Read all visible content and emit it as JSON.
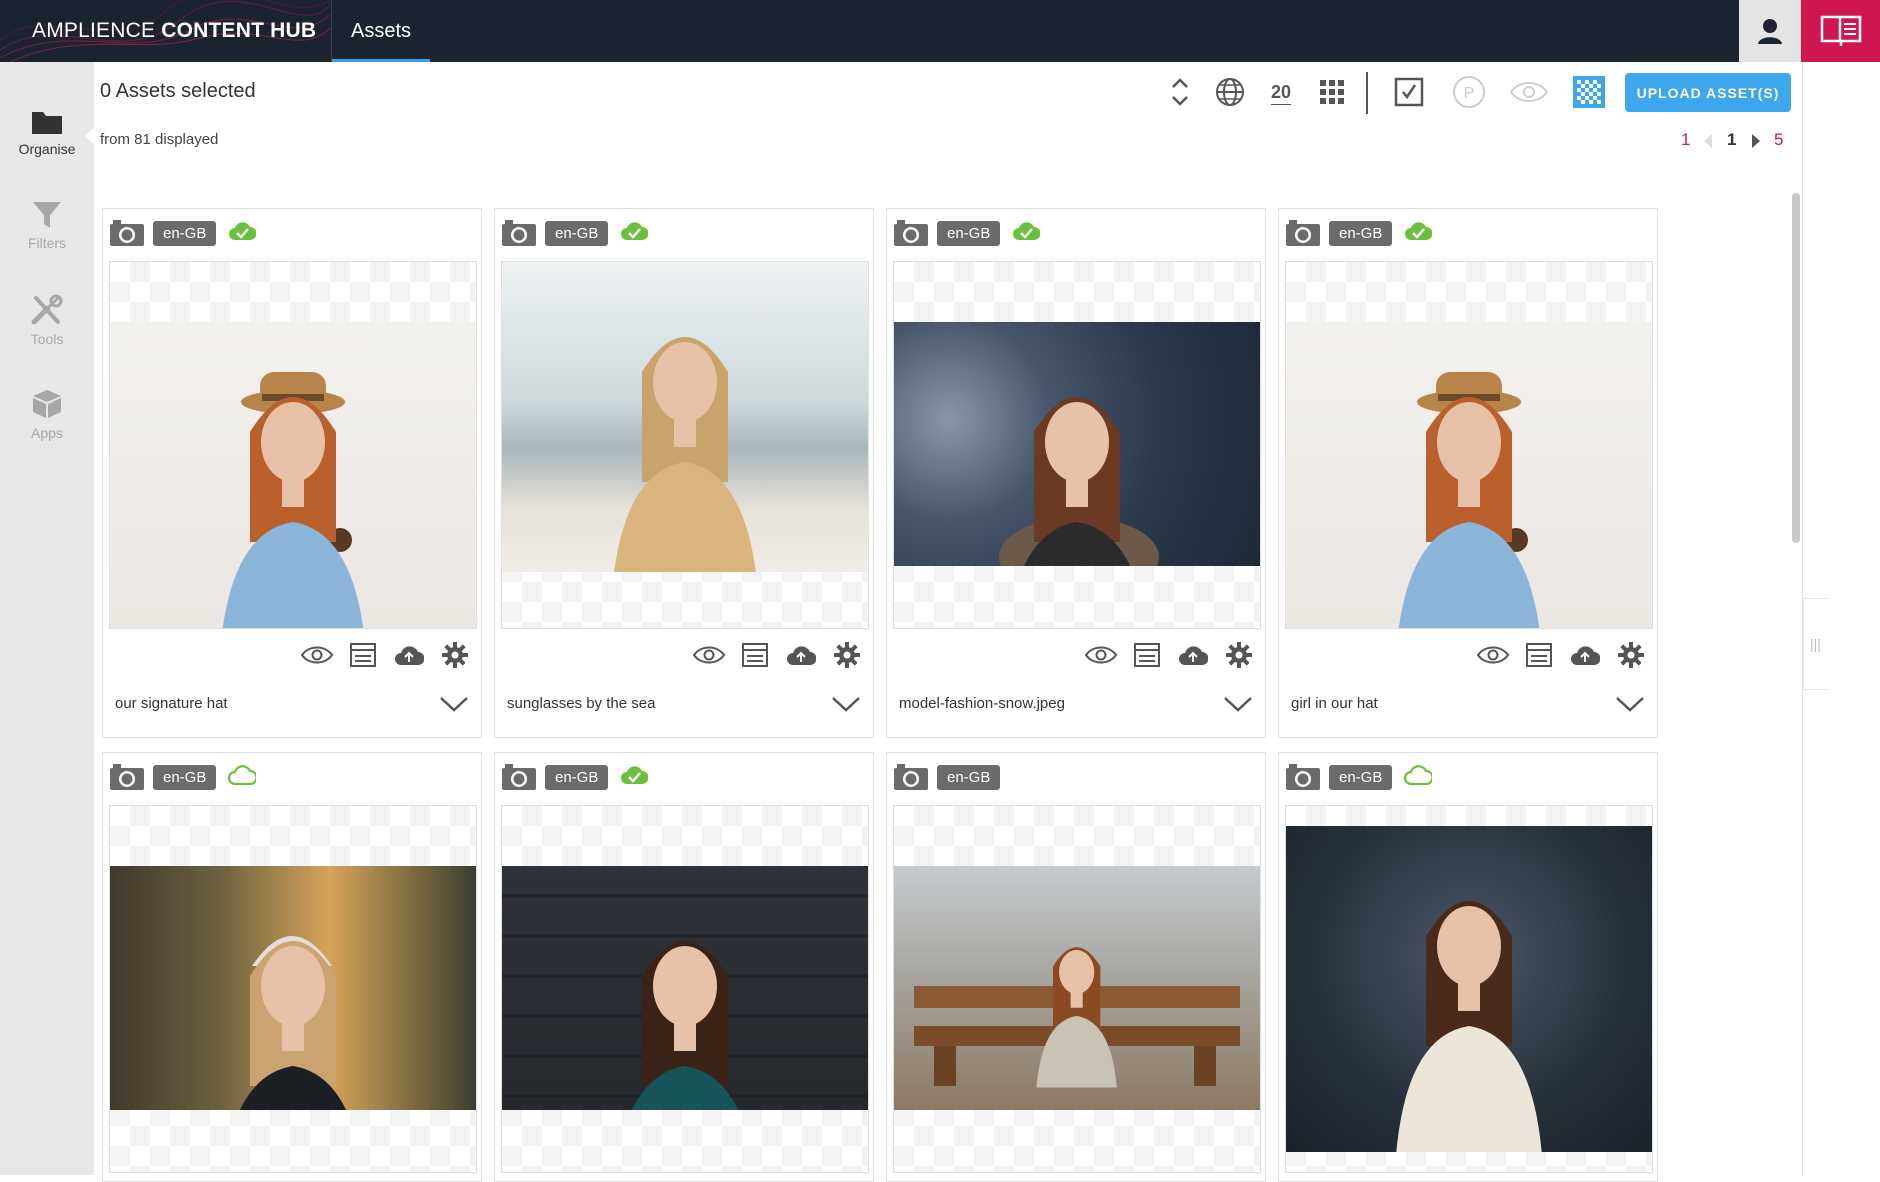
{
  "topbar": {
    "brand_light": "AMPLIENCE ",
    "brand_bold": "CONTENT HUB",
    "tab_label": "Assets",
    "colors": {
      "bg": "#1b2230",
      "accent": "#d0164f",
      "tab_underline": "#3aa0e8"
    }
  },
  "sidebar": {
    "items": [
      {
        "label": "Organise",
        "icon": "folder-icon",
        "active": true
      },
      {
        "label": "Filters",
        "icon": "filter-icon",
        "active": false
      },
      {
        "label": "Tools",
        "icon": "tools-icon",
        "active": false
      },
      {
        "label": "Apps",
        "icon": "box-icon",
        "active": false
      }
    ]
  },
  "toolbar": {
    "selected_label": "0 Assets selected",
    "displayed_label": "from 81 displayed",
    "page_size": "20",
    "upload_label": "UPLOAD ASSET(S)",
    "upload_color": "#3ea6ec"
  },
  "pagination": {
    "first": "1",
    "current": "1",
    "last": "5"
  },
  "assets": [
    {
      "name": "our signature hat",
      "locale": "en-GB",
      "status": "published"
    },
    {
      "name": "sunglasses by the sea",
      "locale": "en-GB",
      "status": "published"
    },
    {
      "name": "model-fashion-snow.jpeg",
      "locale": "en-GB",
      "status": "published"
    },
    {
      "name": "girl in our hat",
      "locale": "en-GB",
      "status": "published"
    },
    {
      "locale": "en-GB",
      "status": "unpublished"
    },
    {
      "locale": "en-GB",
      "status": "published"
    },
    {
      "locale": "en-GB",
      "status": "none"
    },
    {
      "locale": "en-GB",
      "status": "unpublished"
    }
  ]
}
